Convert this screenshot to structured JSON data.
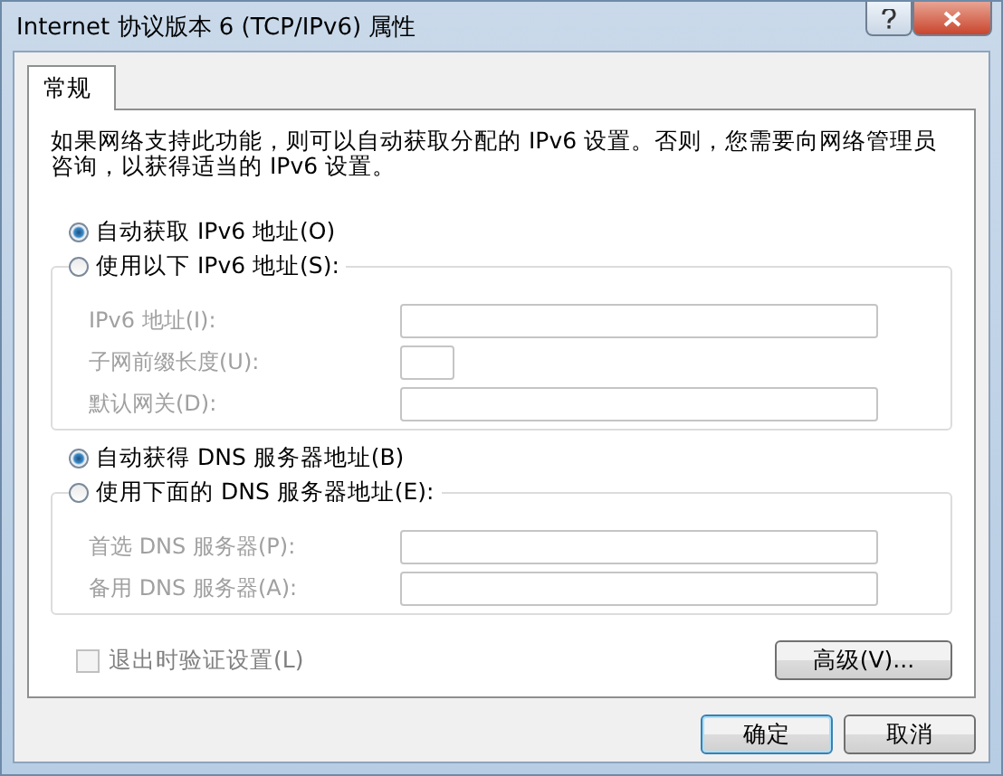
{
  "window": {
    "title": "Internet 协议版本 6 (TCP/IPv6) 属性"
  },
  "tabs": [
    {
      "label": "常规",
      "selected": true
    }
  ],
  "description": "如果网络支持此功能，则可以自动获取分配的 IPv6 设置。否则，您需要向网络管理员咨询，以获得适当的 IPv6 设置。",
  "ipv6_address": {
    "options": [
      {
        "label": "自动获取 IPv6 地址(O)",
        "selected": true
      },
      {
        "label": "使用以下 IPv6 地址(S):",
        "selected": false
      }
    ],
    "fields": [
      {
        "label": "IPv6 地址(I):",
        "kind": "wide",
        "disabled": true
      },
      {
        "label": "子网前缀长度(U):",
        "kind": "short",
        "disabled": true
      },
      {
        "label": "默认网关(D):",
        "kind": "wide",
        "disabled": true
      }
    ]
  },
  "dns": {
    "options": [
      {
        "label": "自动获得 DNS 服务器地址(B)",
        "selected": true
      },
      {
        "label": "使用下面的 DNS 服务器地址(E):",
        "selected": false
      }
    ],
    "fields": [
      {
        "label": "首选 DNS 服务器(P):",
        "kind": "wide",
        "disabled": true
      },
      {
        "label": "备用 DNS 服务器(A):",
        "kind": "wide",
        "disabled": true
      }
    ]
  },
  "validate_checkbox": {
    "label": "退出时验证设置(L)",
    "checked": false,
    "disabled": true
  },
  "advanced_button": "高级(V)...",
  "buttons": [
    {
      "label": "确定",
      "kind": "default"
    },
    {
      "label": "取消",
      "kind": "normal"
    }
  ]
}
